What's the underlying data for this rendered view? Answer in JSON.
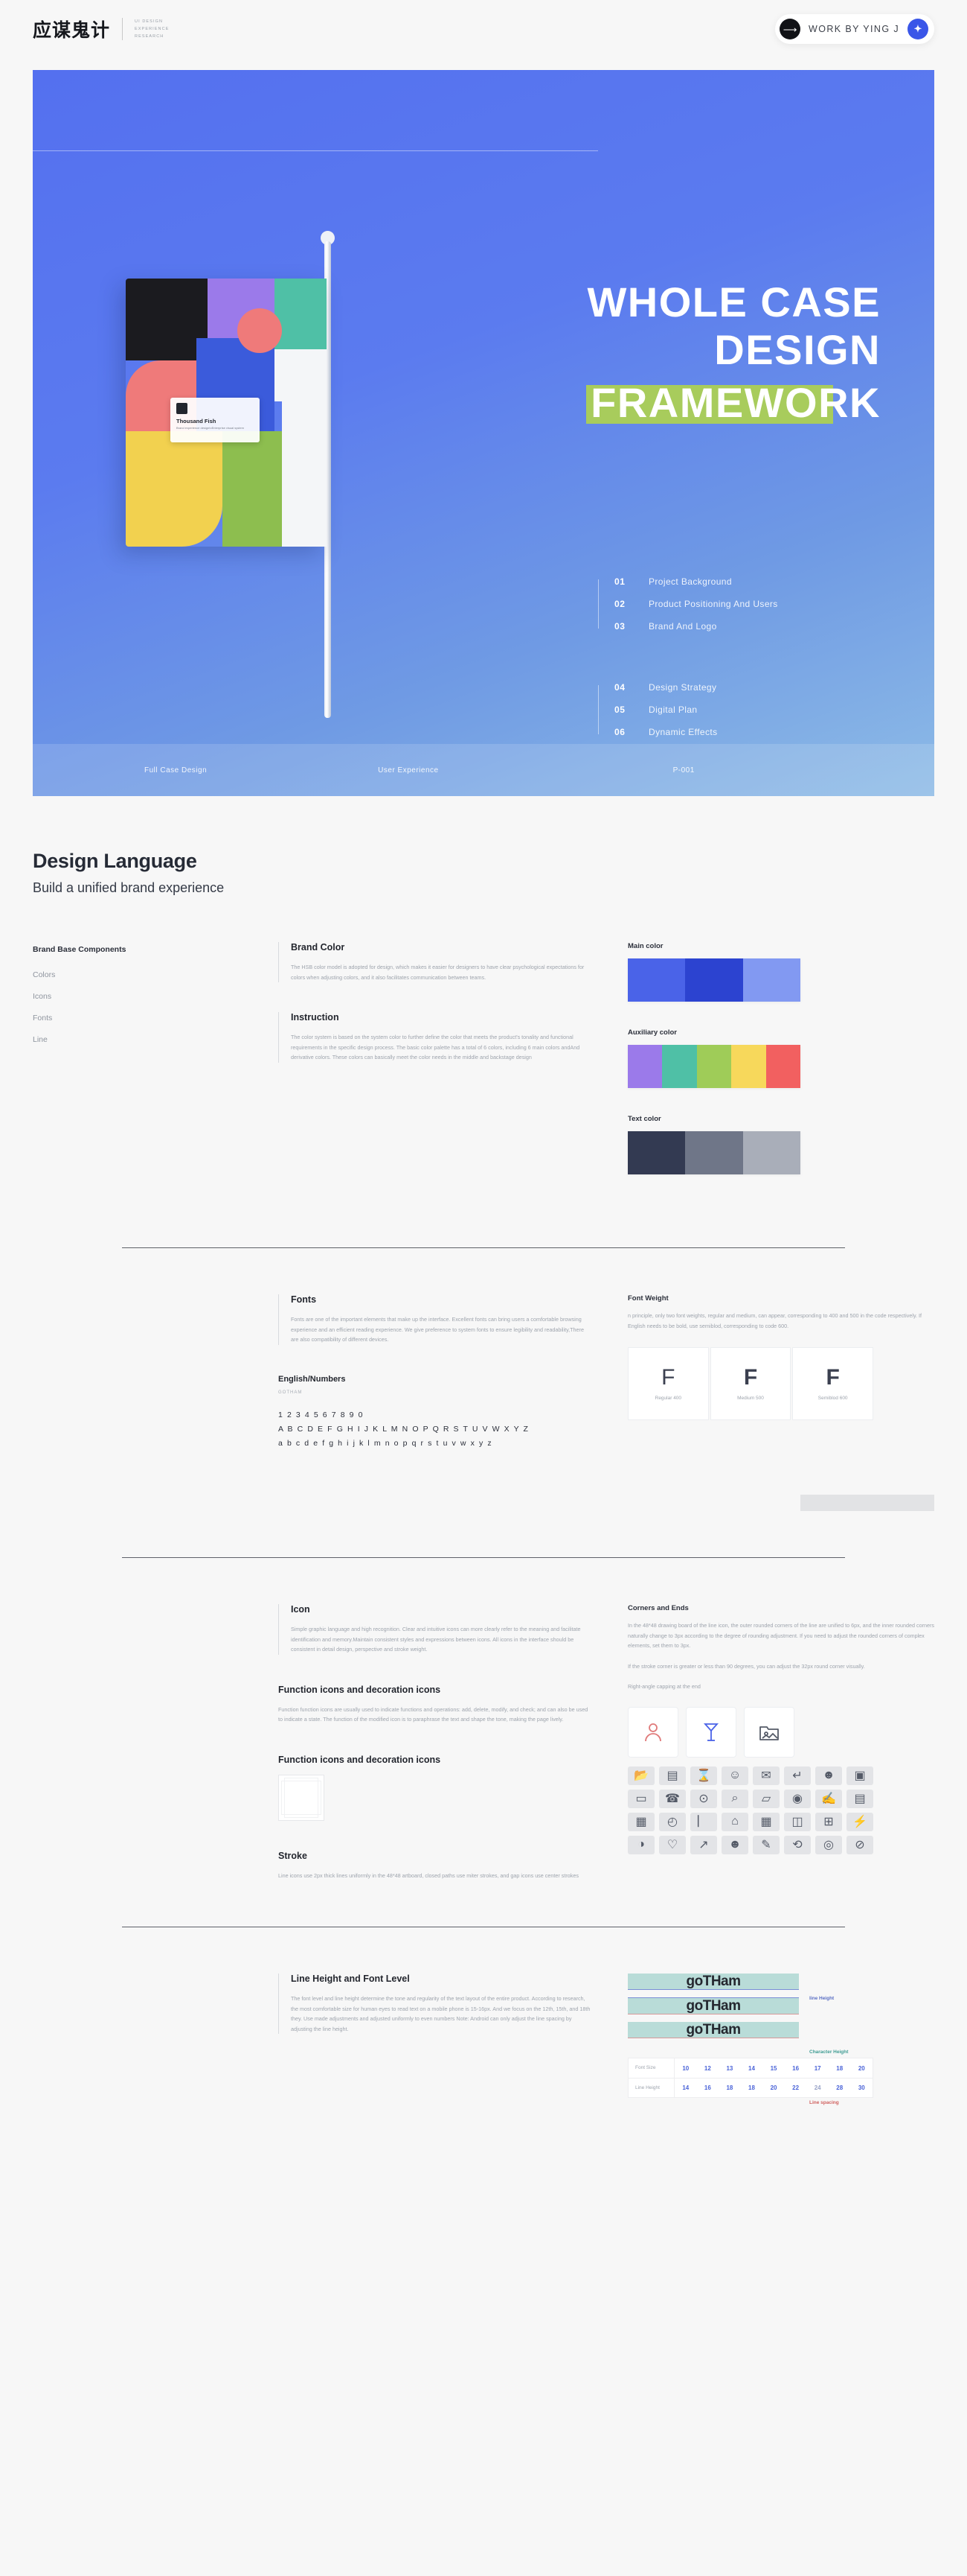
{
  "header": {
    "brand_cn": "应谋鬼计",
    "brand_en_lines": [
      "UI DESIGN",
      "EXPERIENCE",
      "RESEARCH"
    ],
    "work_label": "WORK BY YING J",
    "arrow_icon": "arrow-right-icon",
    "badge_icon": "bird-badge-icon"
  },
  "hero": {
    "title_line1": "WHOLE CASE",
    "title_line2": "DESIGN",
    "title_line3": "FRAMEWORK",
    "highlight_color": "#a8cc5c",
    "agenda_group_1": [
      {
        "num": "01",
        "label": "Project Background"
      },
      {
        "num": "02",
        "label": "Product Positioning And Users"
      },
      {
        "num": "03",
        "label": "Brand And Logo"
      }
    ],
    "agenda_group_2": [
      {
        "num": "04",
        "label": "Design Strategy"
      },
      {
        "num": "05",
        "label": "Digital Plan"
      },
      {
        "num": "06",
        "label": "Dynamic Effects"
      }
    ],
    "footer_left": "Full Case Design",
    "footer_mid": "User Experience",
    "footer_right": "P-001",
    "flag_card_title": "Thousand Fish",
    "flag_card_sub": "Brand experience design\\nEnterprise visual system"
  },
  "section": {
    "title": "Design Language",
    "subtitle": "Build a unified brand experience"
  },
  "sidebar": {
    "title": "Brand Base Components",
    "items": [
      "Colors",
      "Icons",
      "Fonts",
      "Line"
    ]
  },
  "brand_color": {
    "title": "Brand Color",
    "body": "The HSB color model is adopted for design, which makes it easier for designers to have clear psychological expectations for colors when adjusting colors, and it also facilitates communication between teams.",
    "instruction_title": "Instruction",
    "instruction_body": "The color system is based on the system color to further define the color that meets the product's tonality and functional requirements in the specific design process. The basic color palette has a total of 6 colors, including 6 main colors andAnd derivative colors. These colors can basically meet the color needs in the middle and backstage design"
  },
  "palettes": [
    {
      "title": "Main color",
      "colors": [
        "#4a63e8",
        "#2c43d0",
        "#8299f2"
      ]
    },
    {
      "title": "Auxiliary color",
      "colors": [
        "#9b7aea",
        "#4fc0a6",
        "#9fcc58",
        "#f7d85b",
        "#f26060"
      ]
    },
    {
      "title": "Text color",
      "colors": [
        "#333a52",
        "#6f7688",
        "#a9aeb9"
      ]
    }
  ],
  "fonts": {
    "title": "Fonts",
    "body": "Fonts are one of the important elements that make up the interface. Excellent fonts can bring users a comfortable browsing experience and an efficient reading experience. We give preference to system fonts to ensure legibility and readability,There are also compatibility of different devices.",
    "spec_title": "English/Numbers",
    "spec_family": "GOTHAM",
    "spec_numbers": "1 2 3 4 5 6 7 8 9 0",
    "spec_upper": "A B C D E F G H I J K L M N O P Q R S T U V W X Y Z",
    "spec_lower": "a b c d e f g h i j k l m n o p q r s t u v w x y z"
  },
  "font_weight": {
    "title": "Font Weight",
    "body": "n principle, only two font weights, regular and medium, can appear, corresponding to 400 and 500 in the code respectively. If English needs to be bold, use semiblod, corresponding to code 600.",
    "cards": [
      {
        "glyph": "F",
        "label": "Regular 400",
        "weight": 400
      },
      {
        "glyph": "F",
        "label": "Medium 500",
        "weight": 600
      },
      {
        "glyph": "F",
        "label": "Semiblod 600",
        "weight": 800
      }
    ]
  },
  "icon": {
    "title": "Icon",
    "body": "Simple graphic language and high recognition. Clear and intuitive icons can more clearly refer to the meaning and facilitate identification and memory.Maintain consistent styles and expressions between icons. All icons in the interface should be consistent in detail design, perspective and stroke weight.",
    "function_title": "Function icons and decoration icons",
    "function_body": "Function function icons are usually used to indicate functions and operations: add, delete, modify, and check; and can also be used to indicate a state. The function of the modified icon is to paraphrase the text and shape the tone, making the page lively.",
    "grid_title": "Function icons and decoration icons",
    "stroke_title": "Stroke",
    "stroke_body": "Line icons use 2px thick lines uniformly in the 48*48 artboard, closed paths use miter strokes, and gap icons use center strokes"
  },
  "corners": {
    "title": "Corners and Ends",
    "body1": "In the 48*48 drawing board of the line icon, the outer rounded corners of the line are unified to 6px, and the inner rounded corners naturally change to 3px according to the degree of rounding adjustment. If you need to adjust the rounded corners of complex elements, set them to 3px.",
    "body2": "If the stroke corner is greater or less than 90 degrees, you can adjust the 32px round corner visually.",
    "body3": "Right-angle capping at the end"
  },
  "line_height": {
    "title": "Line Height and Font Level",
    "body": "The font level and line height determine the tone and regularity of the text layout of the entire product. According to research, the most comfortable size for human eyes to read text on a mobile phone is 15-16px. And we focus on the 12th, 15th, and 18th they. Use made adjustments and adjusted uniformly to even numbers Note: Android can only adjust the line spacing by adjusting the line height.",
    "sample_word": "goTHam",
    "legend": [
      "line Height",
      "Character Height",
      "Line spacing"
    ],
    "table": {
      "row1_label": "Font Size",
      "row1_values": [
        "10",
        "12",
        "13",
        "14",
        "15",
        "16",
        "17",
        "18",
        "20"
      ],
      "row2_label": "Line Height",
      "row2_values": [
        "14",
        "16",
        "18",
        "18",
        "20",
        "22",
        "24",
        "28",
        "30"
      ]
    }
  },
  "flag_colors": {
    "black": "#1b1b1f",
    "coral": "#ef7a7a",
    "purple": "#9b7aea",
    "teal": "#4fc0a6",
    "blue": "#3b5bdb",
    "white": "#f4f6f8",
    "yellow": "#f2d14f",
    "green": "#8dbe4f"
  },
  "icon_grid_glyphs": [
    "🖿",
    "▤",
    "⌛",
    "☺",
    "✉",
    "↵",
    "☻",
    "▣",
    "▭",
    "℘",
    "⊙",
    "⌕",
    "▱",
    "◉",
    "✍",
    "▤",
    "▨",
    "◔",
    "⌸",
    "⌂",
    "▦",
    "◫",
    "⊞",
    "⌁",
    "◑",
    "♡",
    "↗",
    "☻",
    "✎",
    "⟲",
    "◯",
    "⊘"
  ]
}
